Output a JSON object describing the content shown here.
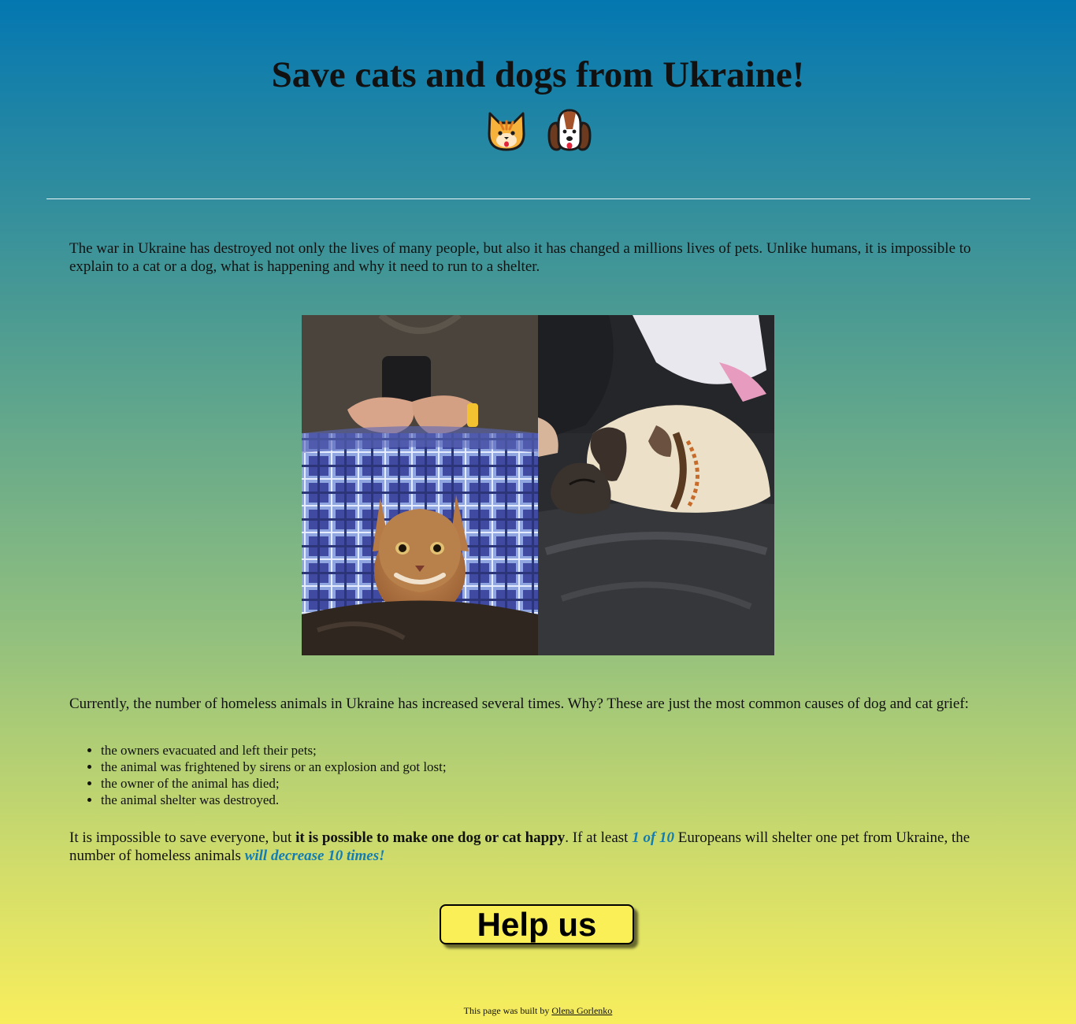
{
  "header": {
    "title": "Save cats and dogs from Ukraine!",
    "emojis": [
      "cat-face-icon",
      "dog-face-icon"
    ]
  },
  "intro": "The war in Ukraine has destroyed not only the lives of many people, but also it has changed a millions lives of pets. Unlike humans, it is impossible to explain to a cat or a dog, what is happening and why it need to run to a shelter.",
  "photos": [
    "abyssinian-cat-photo",
    "sleeping-pug-photo"
  ],
  "causes_intro": "Currently, the number of homeless animals in Ukraine has increased several times. Why? These are just the most common causes of dog and cat grief:",
  "causes": [
    "the owners evacuated and left their pets;",
    "the animal was frightened by sirens or an explosion and got lost;",
    "the owner of the animal has died;",
    "the animal shelter was destroyed."
  ],
  "closing": {
    "part1": "It is impossible to save everyone, but ",
    "bold": "it is possible to make one dog or cat happy",
    "part2": ". If at least ",
    "accent1": "1 of 10",
    "part3": " Europeans will shelter one pet from Ukraine, the number of homeless animals ",
    "accent2": "will decrease 10 times!"
  },
  "cta": {
    "label": "Help us"
  },
  "footer": {
    "text": "This page was built by ",
    "author": "Olena Gorlenko"
  },
  "colors": {
    "top": "#0477b1",
    "bottom": "#f8ee5d",
    "accent": "#137cb3",
    "button": "#fbef58"
  }
}
